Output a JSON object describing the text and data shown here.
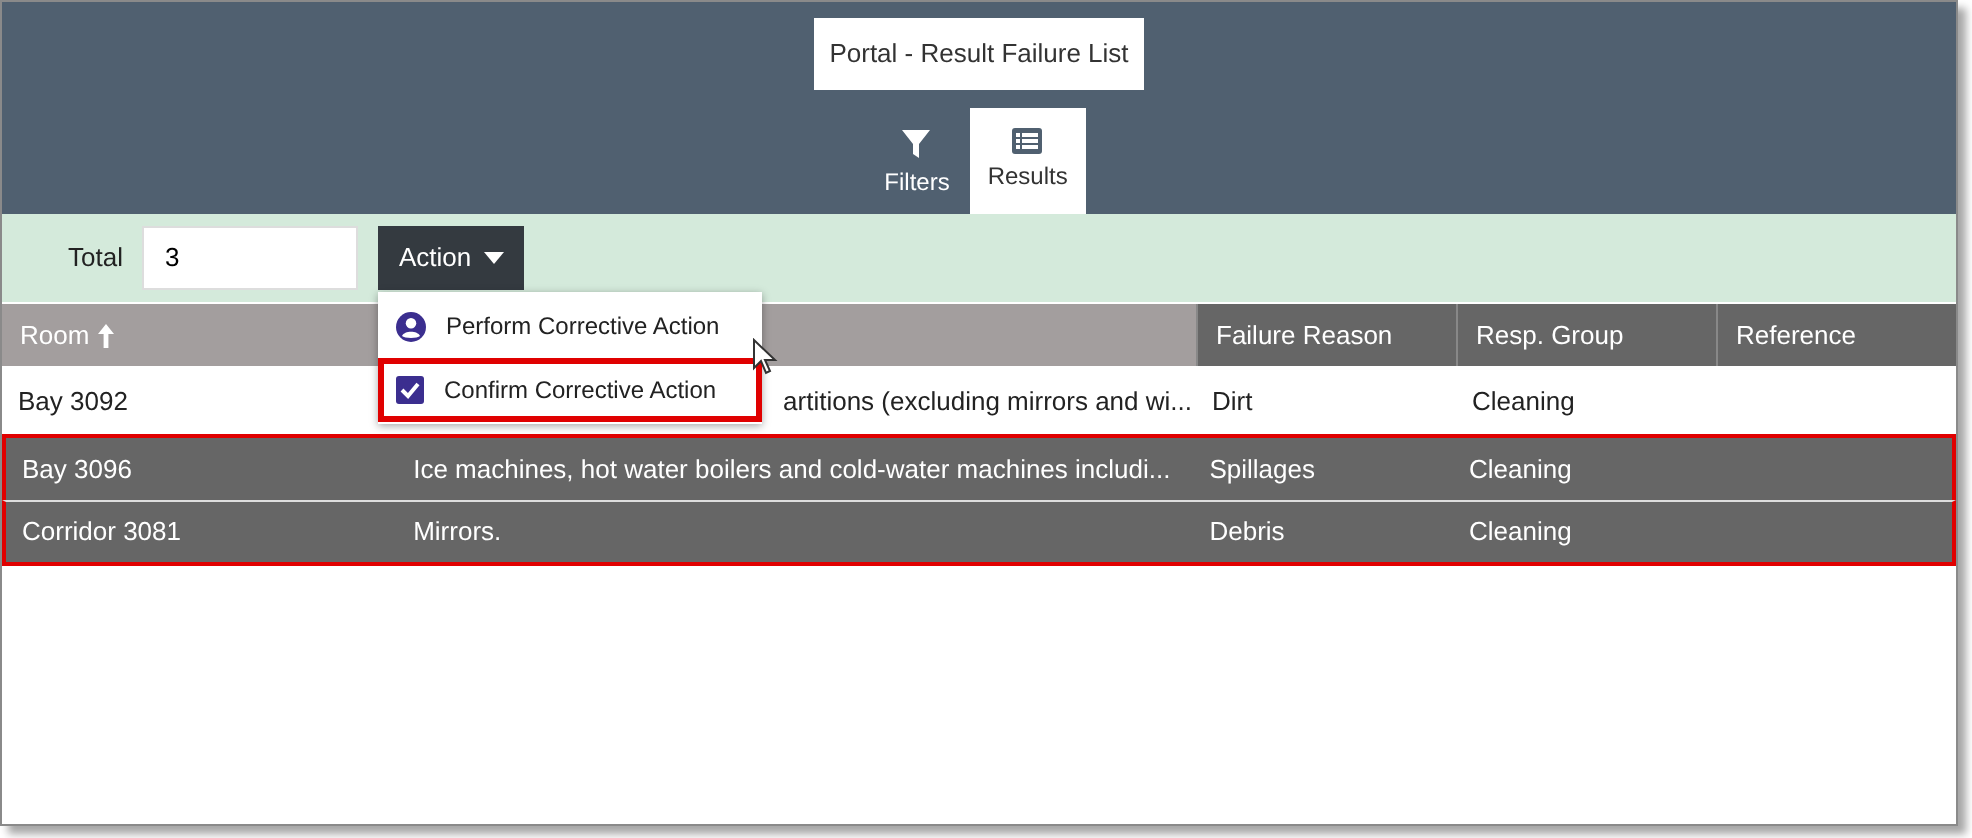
{
  "window": {
    "title": "Portal - Result Failure List"
  },
  "tabs": [
    {
      "label": "Filters",
      "kind": "filter",
      "selected": false
    },
    {
      "label": "Results",
      "kind": "list",
      "selected": true
    }
  ],
  "toolbar": {
    "total_label": "Total",
    "total_value": "3",
    "action_button": "Action"
  },
  "action_menu": [
    {
      "label": "Perform Corrective Action",
      "kind": "user",
      "selected": false
    },
    {
      "label": "Confirm Corrective Action",
      "kind": "check",
      "selected": true
    }
  ],
  "table": {
    "columns": [
      {
        "label": "Room",
        "sorted": true
      },
      {},
      {
        "label": "Failure Reason",
        "sorted": false
      },
      {
        "label": "Resp. Group",
        "sorted": false
      },
      {
        "label": "Reference",
        "sorted": false
      }
    ],
    "rows": [
      {
        "selected": false,
        "cells": [
          "Bay 3092",
          "artitions (excluding mirrors and wi...",
          "Dirt",
          "Cleaning",
          ""
        ]
      },
      {
        "selected": true,
        "cells": [
          "Bay 3096",
          "Ice machines, hot water boilers and cold-water machines includi...",
          "Spillages",
          "Cleaning",
          ""
        ]
      },
      {
        "selected": true,
        "cells": [
          "Corridor 3081",
          "Mirrors.",
          "Debris",
          "Cleaning",
          ""
        ]
      }
    ]
  }
}
